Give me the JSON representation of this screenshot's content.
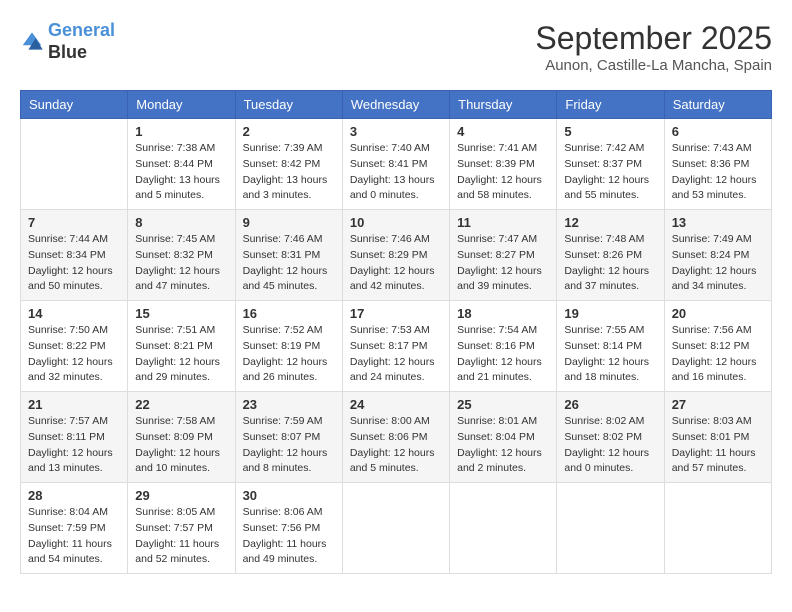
{
  "header": {
    "logo_line1": "General",
    "logo_line2": "Blue",
    "month_title": "September 2025",
    "location": "Aunon, Castille-La Mancha, Spain"
  },
  "weekdays": [
    "Sunday",
    "Monday",
    "Tuesday",
    "Wednesday",
    "Thursday",
    "Friday",
    "Saturday"
  ],
  "weeks": [
    [
      {
        "day": "",
        "sunrise": "",
        "sunset": "",
        "daylight": ""
      },
      {
        "day": "1",
        "sunrise": "Sunrise: 7:38 AM",
        "sunset": "Sunset: 8:44 PM",
        "daylight": "Daylight: 13 hours and 5 minutes."
      },
      {
        "day": "2",
        "sunrise": "Sunrise: 7:39 AM",
        "sunset": "Sunset: 8:42 PM",
        "daylight": "Daylight: 13 hours and 3 minutes."
      },
      {
        "day": "3",
        "sunrise": "Sunrise: 7:40 AM",
        "sunset": "Sunset: 8:41 PM",
        "daylight": "Daylight: 13 hours and 0 minutes."
      },
      {
        "day": "4",
        "sunrise": "Sunrise: 7:41 AM",
        "sunset": "Sunset: 8:39 PM",
        "daylight": "Daylight: 12 hours and 58 minutes."
      },
      {
        "day": "5",
        "sunrise": "Sunrise: 7:42 AM",
        "sunset": "Sunset: 8:37 PM",
        "daylight": "Daylight: 12 hours and 55 minutes."
      },
      {
        "day": "6",
        "sunrise": "Sunrise: 7:43 AM",
        "sunset": "Sunset: 8:36 PM",
        "daylight": "Daylight: 12 hours and 53 minutes."
      }
    ],
    [
      {
        "day": "7",
        "sunrise": "Sunrise: 7:44 AM",
        "sunset": "Sunset: 8:34 PM",
        "daylight": "Daylight: 12 hours and 50 minutes."
      },
      {
        "day": "8",
        "sunrise": "Sunrise: 7:45 AM",
        "sunset": "Sunset: 8:32 PM",
        "daylight": "Daylight: 12 hours and 47 minutes."
      },
      {
        "day": "9",
        "sunrise": "Sunrise: 7:46 AM",
        "sunset": "Sunset: 8:31 PM",
        "daylight": "Daylight: 12 hours and 45 minutes."
      },
      {
        "day": "10",
        "sunrise": "Sunrise: 7:46 AM",
        "sunset": "Sunset: 8:29 PM",
        "daylight": "Daylight: 12 hours and 42 minutes."
      },
      {
        "day": "11",
        "sunrise": "Sunrise: 7:47 AM",
        "sunset": "Sunset: 8:27 PM",
        "daylight": "Daylight: 12 hours and 39 minutes."
      },
      {
        "day": "12",
        "sunrise": "Sunrise: 7:48 AM",
        "sunset": "Sunset: 8:26 PM",
        "daylight": "Daylight: 12 hours and 37 minutes."
      },
      {
        "day": "13",
        "sunrise": "Sunrise: 7:49 AM",
        "sunset": "Sunset: 8:24 PM",
        "daylight": "Daylight: 12 hours and 34 minutes."
      }
    ],
    [
      {
        "day": "14",
        "sunrise": "Sunrise: 7:50 AM",
        "sunset": "Sunset: 8:22 PM",
        "daylight": "Daylight: 12 hours and 32 minutes."
      },
      {
        "day": "15",
        "sunrise": "Sunrise: 7:51 AM",
        "sunset": "Sunset: 8:21 PM",
        "daylight": "Daylight: 12 hours and 29 minutes."
      },
      {
        "day": "16",
        "sunrise": "Sunrise: 7:52 AM",
        "sunset": "Sunset: 8:19 PM",
        "daylight": "Daylight: 12 hours and 26 minutes."
      },
      {
        "day": "17",
        "sunrise": "Sunrise: 7:53 AM",
        "sunset": "Sunset: 8:17 PM",
        "daylight": "Daylight: 12 hours and 24 minutes."
      },
      {
        "day": "18",
        "sunrise": "Sunrise: 7:54 AM",
        "sunset": "Sunset: 8:16 PM",
        "daylight": "Daylight: 12 hours and 21 minutes."
      },
      {
        "day": "19",
        "sunrise": "Sunrise: 7:55 AM",
        "sunset": "Sunset: 8:14 PM",
        "daylight": "Daylight: 12 hours and 18 minutes."
      },
      {
        "day": "20",
        "sunrise": "Sunrise: 7:56 AM",
        "sunset": "Sunset: 8:12 PM",
        "daylight": "Daylight: 12 hours and 16 minutes."
      }
    ],
    [
      {
        "day": "21",
        "sunrise": "Sunrise: 7:57 AM",
        "sunset": "Sunset: 8:11 PM",
        "daylight": "Daylight: 12 hours and 13 minutes."
      },
      {
        "day": "22",
        "sunrise": "Sunrise: 7:58 AM",
        "sunset": "Sunset: 8:09 PM",
        "daylight": "Daylight: 12 hours and 10 minutes."
      },
      {
        "day": "23",
        "sunrise": "Sunrise: 7:59 AM",
        "sunset": "Sunset: 8:07 PM",
        "daylight": "Daylight: 12 hours and 8 minutes."
      },
      {
        "day": "24",
        "sunrise": "Sunrise: 8:00 AM",
        "sunset": "Sunset: 8:06 PM",
        "daylight": "Daylight: 12 hours and 5 minutes."
      },
      {
        "day": "25",
        "sunrise": "Sunrise: 8:01 AM",
        "sunset": "Sunset: 8:04 PM",
        "daylight": "Daylight: 12 hours and 2 minutes."
      },
      {
        "day": "26",
        "sunrise": "Sunrise: 8:02 AM",
        "sunset": "Sunset: 8:02 PM",
        "daylight": "Daylight: 12 hours and 0 minutes."
      },
      {
        "day": "27",
        "sunrise": "Sunrise: 8:03 AM",
        "sunset": "Sunset: 8:01 PM",
        "daylight": "Daylight: 11 hours and 57 minutes."
      }
    ],
    [
      {
        "day": "28",
        "sunrise": "Sunrise: 8:04 AM",
        "sunset": "Sunset: 7:59 PM",
        "daylight": "Daylight: 11 hours and 54 minutes."
      },
      {
        "day": "29",
        "sunrise": "Sunrise: 8:05 AM",
        "sunset": "Sunset: 7:57 PM",
        "daylight": "Daylight: 11 hours and 52 minutes."
      },
      {
        "day": "30",
        "sunrise": "Sunrise: 8:06 AM",
        "sunset": "Sunset: 7:56 PM",
        "daylight": "Daylight: 11 hours and 49 minutes."
      },
      {
        "day": "",
        "sunrise": "",
        "sunset": "",
        "daylight": ""
      },
      {
        "day": "",
        "sunrise": "",
        "sunset": "",
        "daylight": ""
      },
      {
        "day": "",
        "sunrise": "",
        "sunset": "",
        "daylight": ""
      },
      {
        "day": "",
        "sunrise": "",
        "sunset": "",
        "daylight": ""
      }
    ]
  ]
}
